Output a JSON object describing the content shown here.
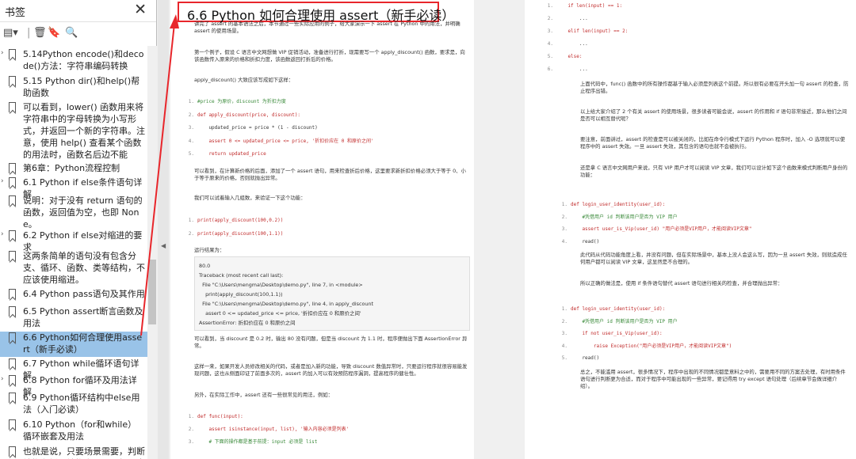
{
  "sidebar": {
    "title": "书签",
    "close": "✕",
    "items": [
      {
        "label": "5.14Python encode()和decode()方法：字符串编码转换",
        "expander": "›"
      },
      {
        "label": "5.15 Python dir()和help()帮助函数"
      },
      {
        "label": "可以看到，lower() 函数用来将字符串中的字母转换为小写形式，并返回一个新的字符串。注意，使用 help() 查看某个函数的用法时，函数名后边不能"
      },
      {
        "label": "第6章：Python流程控制"
      },
      {
        "label": "6.1 Python if else条件语句详解",
        "expander": "›"
      },
      {
        "label": "说明：对于没有 return 语句的函数，返回值为空，也即 None。"
      },
      {
        "label": "6.2 Python if else对缩进的要求",
        "expander": "›"
      },
      {
        "label": "这两条简单的语句没有包含分支、循环、函数、类等结构，不应该使用缩进。"
      },
      {
        "label": "6.4 Python pass语句及其作用"
      },
      {
        "label": "6.5 Python assert断言函数及用法"
      },
      {
        "label": "6.6 Python如何合理使用assert（新手必读）"
      },
      {
        "label": "6.7 Python while循环语句详解"
      },
      {
        "label": "6.8 Python for循环及用法详解",
        "expander": "›"
      },
      {
        "label": "6.9 Python循环结构中else用法（入门必读）"
      },
      {
        "label": "6.10 Python（for和while）循环嵌套及用法"
      },
      {
        "label": "也就是说，只要场景需要，判断结构和循环结构之间可以相互嵌套"
      }
    ]
  },
  "page1": {
    "heading": "6.6 Python 如何合理使用 assert（新手必读）",
    "intro": "讲完了 assert 的基本语法之后，本节通过一些实际应用的例子，给大家演示一下 assert 在 Python 中的用法，并明确 assert 的使用场景。",
    "p1": "第一个例子，假设 C 语言中文网想做 VIP 促销活动，准备进行打折，现需要写一个 apply_discount() 函数，要求是，向该函数传入原来的价格和折扣力度，该函数返回打折后的价格。",
    "p2": "apply_discount() 大致应该写成如下这样：",
    "code1": [
      "#price 为原价，discount 为折扣力度",
      "def apply_discount(price, discount):",
      "    updated_price = price * (1 - discount)",
      "    assert 0 <= updated_price <= price, '折扣价应在 0 和原价之间'",
      "    return updated_price"
    ],
    "p3": "可以看到，在计算新价格的后面，添加了一个 assert 语句，用来检查折后价格，这里要求新折扣价格必须大于等于 0、小于等于原来的价格，否则就抛出异常。",
    "p4": "我们可以试着输入几组数，来验证一下这个功能：",
    "code2": [
      "print(apply_discount(100,0.2))",
      "print(apply_discount(100,1.1))"
    ],
    "p5": "运行结果为：",
    "output": [
      "80.0",
      "Traceback (most recent call last):",
      "  File \"C:\\Users\\mengma\\Desktop\\demo.py\", line 7, in <module>",
      "    print(apply_discount(100,1.1))",
      "  File \"C:\\Users\\mengma\\Desktop\\demo.py\", line 4, in apply_discount",
      "    assert 0 <= updated_price <= price, '折扣价应在 0 和原价之间'",
      "AssertionError: 折扣价应在 0 和原价之间"
    ],
    "p6": "可以看到，当 discount 是 0.2 时，输出 80 没有问题，但是当 discount 为 1.1 时，程序便抛出下面 AssertionError 异常。",
    "p7": "这样一来，如果开发人员修改相关的代码，或者是加入新的功能，导致 discount 数值异常时，只要运行程序就很容易能发现问题，这也从侧面印证了前面多次的，assert 的加入可以有效预防程序漏洞，提高程序的健壮性。",
    "p8": "另外，在实际工作中，assert 还有一些很常见的用法，例如：",
    "code3": [
      "def func(input):",
      "    assert isinstance(input, list), '输入内容必须是列表'",
      "    # 下面的操作都是基于前提：input 必须是 list"
    ]
  },
  "page2": {
    "code4": [
      "    if len(input) == 1:",
      "        ...",
      "    elif len(input) == 2:",
      "        ...",
      "    else:",
      "        ..."
    ],
    "p1": "上面代码中，func() 函数中的所有操作都基于输入必须是列表这个前提。所以很有必要在开头加一句 assert 的检查，防止程序出错。",
    "p2": "以上给大家介绍了 2 个有关 assert 的使用场景，很多读者可能会说，assert 的作用和 if 语句非常接近，那么他们之间是否可以相互替代呢？",
    "p3": "要注意，前面讲过，assert 的检查是可以被关闭的，比如在命令行模式下运行 Python 程序时，加入 -O 选项就可以使程序中的 assert 失效。一旦 assert 失效，其包含的语句也就不会被执行。",
    "p4": "还是拿 C 语言中文网用户来说，只有 VIP 用户才可以阅读 VIP 文章，我们可以设计如下这个函数来模式判断用户身份的功能：",
    "code5": [
      "def login_user_identity(user_id):",
      "    #凭借用户 id 判断该用户是否为 VIP 用户",
      "    assert user_is_Vip(user_id) \"用户必须是VIP用户，才能阅读VIP文章\"",
      "    read()"
    ],
    "p5": "此代码从代码功能角度上看，并没有问题，但在实际场景中，基本上没人会这么写，因为一旦 assert 失效，则就造成任何用户都可以阅读 VIP 文章，这显然是不合理的。",
    "p6": "所以正确的做法是，使用 if 条件语句替代 assert 语句进行相关的检查，并合理抛出异常：",
    "code6": [
      "def login_user_identity(user_id):",
      "    #凭借用户 id 判断该用户是否为 VIP 用户",
      "    if not user_is_Vip(user_id):",
      "        raise Exception(\"用户必须是VIP用户，才能阅读VIP文章\")",
      "    read()"
    ],
    "p7": "总之，不能滥用 assert，很多情况下，程序中出现的不同情况都是意料之中的，需要用不同的方案去处理，有时用条件语句进行判断更为合适，而对于程序中可能出现的一些异常，要记得用 try except 语句处理（后续章节会做详细介绍）。"
  },
  "colors": {
    "selected": "#99c3e8",
    "highlight": "#e8262b",
    "keyword": "#c02a2a",
    "comment": "#3a8a3a"
  }
}
